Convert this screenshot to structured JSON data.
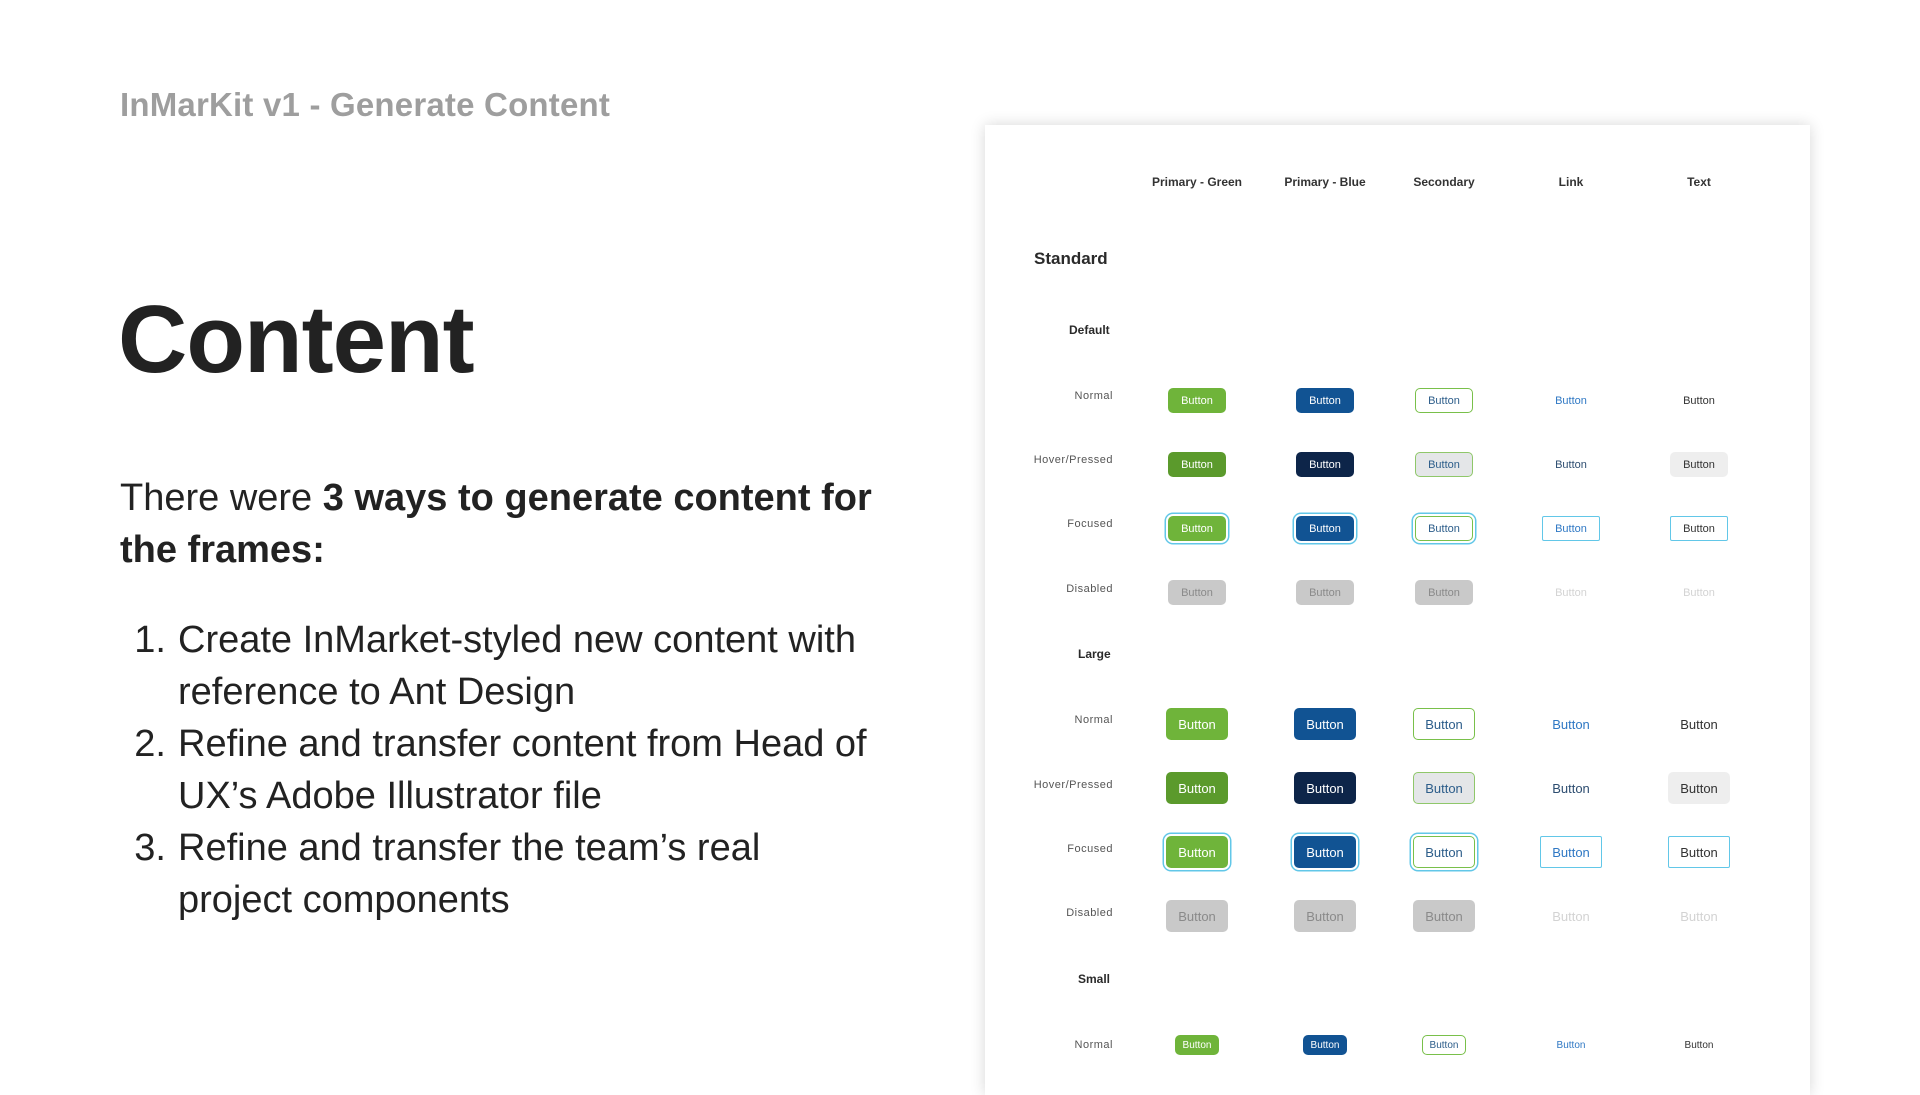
{
  "header": {
    "subtitle": "InMarKit v1 - Generate Content"
  },
  "main": {
    "title": "Content",
    "intro_prefix": "There were ",
    "intro_bold": "3 ways to generate content for the frames:",
    "ways": [
      {
        "num": "1.",
        "text": "Create InMarket-styled new content with reference to Ant Design"
      },
      {
        "num": "2.",
        "text": "Refine and transfer content from Head of UX’s Adobe Illustrator file"
      },
      {
        "num": "3.",
        "text": "Refine and transfer the team’s real project components"
      }
    ]
  },
  "sheet": {
    "columns": [
      "Primary - Green",
      "Primary - Blue",
      "Secondary",
      "Link",
      "Text"
    ],
    "standard_label": "Standard",
    "default_label": "Default",
    "large_label": "Large",
    "small_label": "Small",
    "rows": {
      "normal": "Normal",
      "hover": "Hover/Pressed",
      "focused": "Focused",
      "disabled": "Disabled"
    },
    "button_label": "Button"
  },
  "colors": {
    "primary_green": "#6fb43a",
    "primary_blue": "#115393",
    "hover_blue": "#0d2549",
    "focus_ring": "#62c7e8",
    "disabled": "#c9c9c9",
    "subtitle_gray": "#9e9e9e"
  }
}
